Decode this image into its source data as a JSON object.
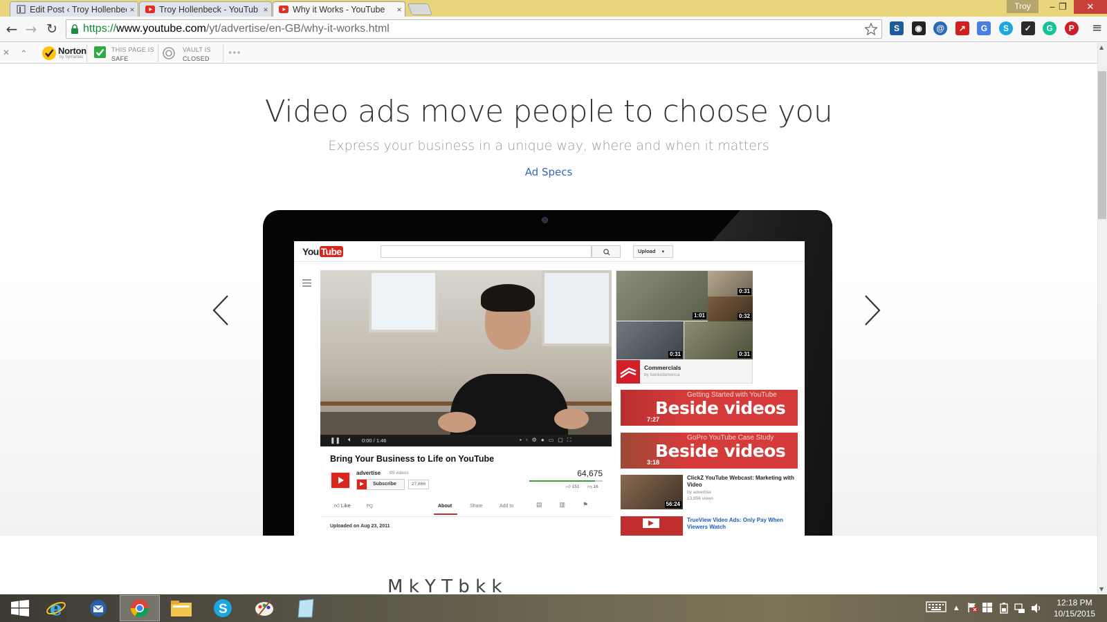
{
  "browser": {
    "tabs": [
      {
        "title": "Edit Post ‹ Troy Hollenbec",
        "icon": "wordpress-icon",
        "close": "×"
      },
      {
        "title": "Troy Hollenbeck - YouTub",
        "icon": "youtube-icon",
        "close": "×"
      },
      {
        "title": "Why it Works - YouTube",
        "icon": "youtube-icon",
        "close": "×",
        "active": true
      }
    ],
    "user": "Troy",
    "window_controls": {
      "minimize": "–",
      "maximize": "❐",
      "close": "✕"
    },
    "nav": {
      "back": "←",
      "forward": "→",
      "reload": "↻"
    },
    "url": {
      "scheme": "https://",
      "host": "www.youtube.com",
      "path": "/yt/advertise/en-GB/why-it-works.html"
    },
    "extensions": [
      {
        "name": "s-ext-icon",
        "label": "S",
        "color": "#1c5e9a"
      },
      {
        "name": "owl-ext-icon",
        "label": "◉",
        "color": "#222222"
      },
      {
        "name": "at-ext-icon",
        "label": "@",
        "color": "#2a6ab7"
      },
      {
        "name": "arrow-ext-icon",
        "label": "↗",
        "color": "#d11f1f"
      },
      {
        "name": "translate-ext-icon",
        "label": "G",
        "color": "#4a7ee0"
      },
      {
        "name": "skype-ext-icon",
        "label": "S",
        "color": "#1aa7e0"
      },
      {
        "name": "check-ext-icon",
        "label": "✓",
        "color": "#2b2b2b"
      },
      {
        "name": "grammarly-ext-icon",
        "label": "G",
        "color": "#15c39a"
      },
      {
        "name": "pinterest-ext-icon",
        "label": "P",
        "color": "#cb2027"
      }
    ],
    "menu": "≡"
  },
  "norton": {
    "close": "✕",
    "collapse": "⌃",
    "brand": "Norton",
    "brand_sub": "by Symantec",
    "safe_line1": "THIS PAGE IS",
    "safe_line2": "SAFE",
    "vault_line1": "VAULT IS",
    "vault_line2": "CLOSED",
    "more": "•••"
  },
  "page": {
    "headline": "Video ads move people to choose you",
    "subhead": "Express your business in a unique way, where and when it matters",
    "link": "Ad Specs",
    "cut_text": "M                                  k  Y  T  b     k         k"
  },
  "yt": {
    "logo_you": "You",
    "logo_tube": "Tube",
    "upload": "Upload",
    "player_time": "0:00 / 1:46",
    "video_title": "Bring Your Business to Life on YouTube",
    "channel": "advertise",
    "channel_count": "· 99 videos",
    "subscribe": "Subscribe",
    "sub_count": "27,866",
    "views": "64,675",
    "likes": "151",
    "dislikes": "16",
    "like": "Like",
    "tabs": [
      "About",
      "Share",
      "Add to"
    ],
    "uploaded": "Uploaded on Aug 23, 2011",
    "playlist_title": "Commercials",
    "playlist_by": "by bankofamerica",
    "durations": [
      "0:31",
      "1:01",
      "0:32",
      "0:31",
      "0:31"
    ],
    "beside": [
      {
        "small": "Getting Started with YouTube",
        "big": "Beside videos",
        "dur": "7:27"
      },
      {
        "small": "GoPro YouTube Case Study",
        "big": "Beside videos",
        "dur": "3:18"
      }
    ],
    "related": [
      {
        "title": "ClickZ YouTube Webcast: Marketing with Video",
        "by": "by advertise",
        "views": "13,956 views",
        "dur": "56:24"
      },
      {
        "title": "TrueView Video Ads: Only Pay When Viewers Watch"
      }
    ]
  },
  "taskbar": {
    "items": [
      "start-button",
      "ie-icon",
      "thunderbird-icon",
      "chrome-icon",
      "file-explorer-icon",
      "skype-icon",
      "paint-icon",
      "notepad-icon"
    ],
    "time": "12:18 PM",
    "date": "10/15/2015"
  }
}
